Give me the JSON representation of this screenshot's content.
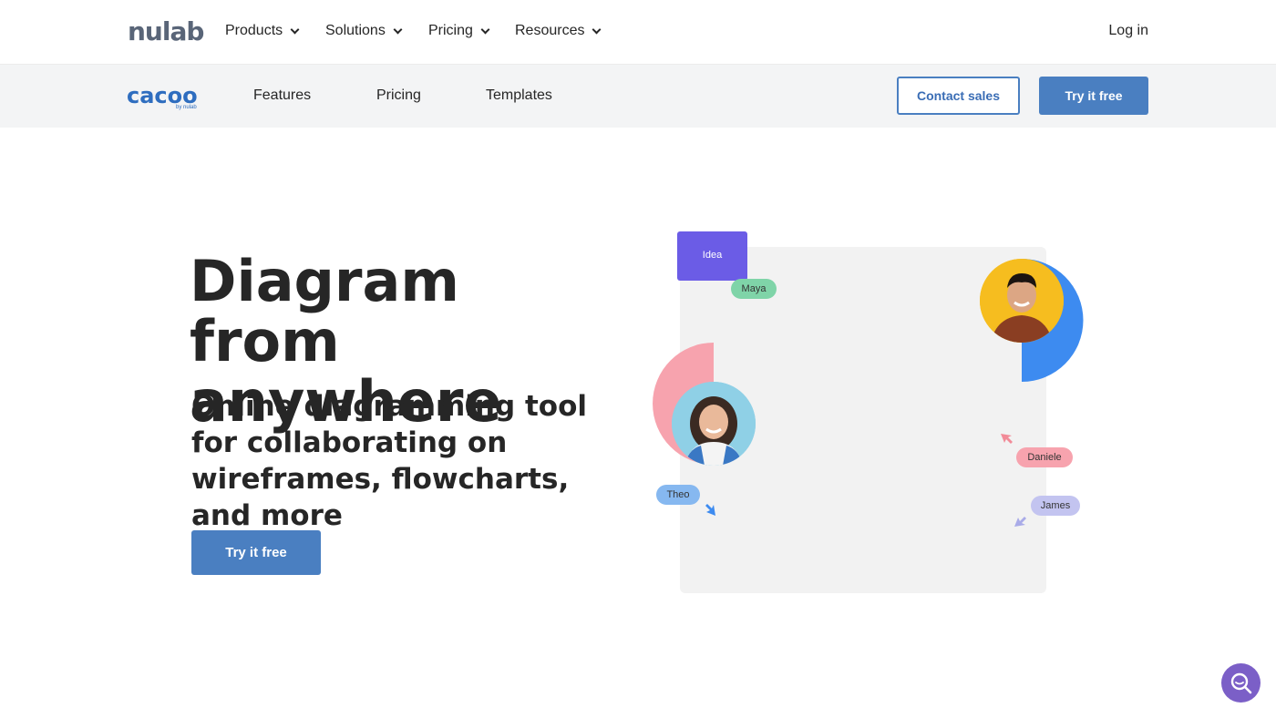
{
  "topnav": {
    "logo": "nulab",
    "items": [
      {
        "label": "Products"
      },
      {
        "label": "Solutions"
      },
      {
        "label": "Pricing"
      },
      {
        "label": "Resources"
      }
    ],
    "login": "Log in"
  },
  "subnav": {
    "logo": "cacoo",
    "logo_by": "by nulab",
    "items": [
      {
        "label": "Features"
      },
      {
        "label": "Pricing"
      },
      {
        "label": "Templates"
      }
    ],
    "contact_sales": "Contact sales",
    "try_free": "Try it free"
  },
  "hero": {
    "title_line1": "Diagram from",
    "title_line2": "anywhere",
    "subtitle": "Online diagramming tool for collaborating on wireframes, flowcharts, and more",
    "cta": "Try it free"
  },
  "illustration": {
    "card_label": "Idea",
    "tags": {
      "maya": "Maya",
      "theo": "Theo",
      "daniele": "Daniele",
      "james": "James"
    }
  },
  "colors": {
    "brand_blue": "#4a7fc1",
    "idea_purple": "#6b5ce6",
    "help_purple": "#7b5fc7"
  },
  "icons": {
    "help": "search-chat-icon"
  }
}
